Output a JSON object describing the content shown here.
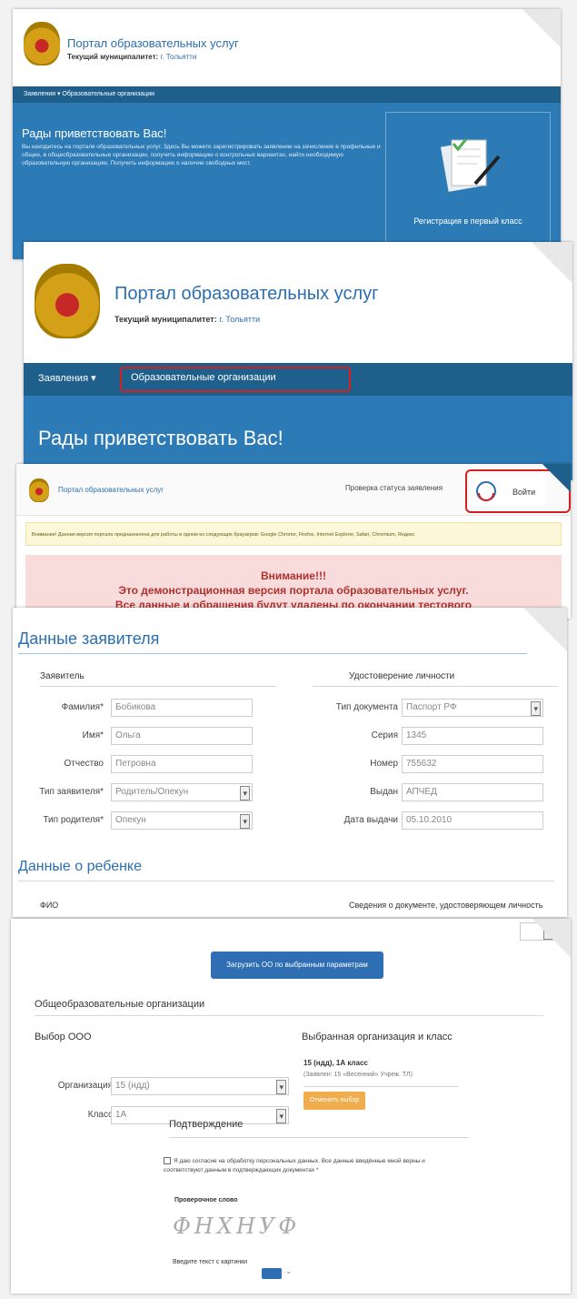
{
  "portal": {
    "title": "Портал образовательных услуг",
    "municipality_label": "Текущий муниципалитет:",
    "municipality_value": "г. Тольятти"
  },
  "frame1": {
    "breadcrumb": "Заявления ▾   Образовательные организации",
    "welcome_title": "Рады приветствовать Вас!",
    "welcome_text": "Вы находитесь на портале образовательных услуг. Здесь Вы можете зарегистрировать заявление на зачисление в профильные и общие, в общеобразовательные организации, получить информацию о контрольных вариантах, найти необходимую образовательную организацию. Получить информацию о наличии свободных мест.",
    "tile_label": "Регистрация в первый класс"
  },
  "frame2": {
    "nav_item_1": "Заявления ▾",
    "nav_item_2": "Образовательные организации",
    "welcome_title": "Рады приветствовать Вас!"
  },
  "frame3": {
    "status_link": "Проверка статуса заявления",
    "login_label": "Войти",
    "notice": "Внимание! Данная версия портала предназначена для работы в одном из следующих браузеров: Google Chrome, Firefox, Internet Explorer, Safari, Chromium, Яндекс",
    "warning_title": "Внимание!!!",
    "warning_line1": "Это демонстрационная версия портала образовательных услуг.",
    "warning_line2": "Все данные и обращения будут удалены по окончании тестового"
  },
  "frame4": {
    "section_title": "Данные заявителя",
    "applicant_header": "Заявитель",
    "identity_header": "Удостоверение личности",
    "fields_left": [
      {
        "label": "Фамилия*",
        "value": "Бобикова",
        "select": false
      },
      {
        "label": "Имя*",
        "value": "Ольга",
        "select": false
      },
      {
        "label": "Отчество",
        "value": "Петровна",
        "select": false
      },
      {
        "label": "Тип заявителя*",
        "value": "Родитель/Опекун",
        "select": true
      },
      {
        "label": "Тип родителя*",
        "value": "Опекун",
        "select": true
      }
    ],
    "fields_right": [
      {
        "label": "Тип документа",
        "value": "Паспорт РФ",
        "select": true
      },
      {
        "label": "Серия",
        "value": "1345",
        "select": false
      },
      {
        "label": "Номер",
        "value": "755632",
        "select": false
      },
      {
        "label": "Выдан",
        "value": "АПЧЕД",
        "select": false
      },
      {
        "label": "Дата выдачи",
        "value": "05.10.2010",
        "select": false
      }
    ],
    "child_title": "Данные о ребенке",
    "child_fio": "ФИО",
    "child_doc": "Сведения о документе, удостоверяющем личность"
  },
  "frame5": {
    "load_button": "Загрузить ОО по выбранным параметрам",
    "orgs_header": "Общеобразовательные организации",
    "choose_header": "Выбор ООО",
    "selected_header": "Выбранная организация и класс",
    "school_label": "Организация",
    "school_value": "15 (ндд)",
    "class_label": "Класс",
    "class_value": "1А",
    "selected_org": "15 (ндд), 1А класс",
    "selected_addr": "(Заявлен: 15 «Весенний» Учреж. ТЛ)",
    "change_button": "Отменить выбор",
    "confirm_header": "Подтверждение",
    "consent_text": "Я даю согласие на обработку персональных данных. Все данные введённые мной верны и соответствуют данным в подтверждающих документах *",
    "captcha_label": "Проверочное слово",
    "captcha_text": "ФНХНУФ",
    "captcha_input_label": "Введите текст с картинки"
  },
  "colors": {
    "brand_blue": "#2c7bb6",
    "nav_dark": "#1f5f8b",
    "highlight_red": "#d61f1f",
    "warning_bg": "#f8dcdc",
    "notice_bg": "#fcf7d8",
    "button_orange": "#f0ad4e"
  }
}
